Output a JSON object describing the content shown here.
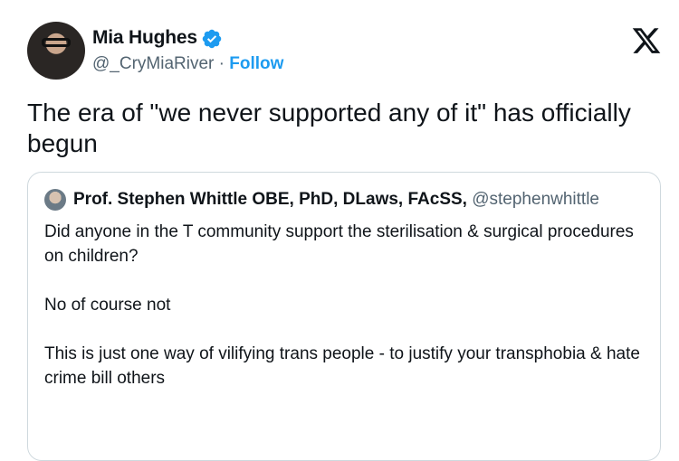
{
  "author": {
    "name": "Mia Hughes",
    "handle": "@_CryMiaRiver",
    "separator": " · ",
    "follow_label": "Follow"
  },
  "tweet": {
    "text": "The era of \"we never supported any of it\" has officially begun"
  },
  "quoted": {
    "name": "Prof. Stephen Whittle OBE, PhD, DLaws, FAcSS,",
    "handle": "@stephenwhittle",
    "paragraphs": [
      "Did anyone in the T community support the sterilisation & surgical procedures on children?",
      "No of course not",
      "This is just one way of vilifying trans people - to justify your transphobia & hate crime bill others"
    ]
  },
  "icons": {
    "verified": "verified-badge-icon",
    "logo": "x-logo-icon"
  },
  "colors": {
    "link": "#1d9bf0",
    "secondary_text": "#536471",
    "border": "#cfd9de"
  }
}
